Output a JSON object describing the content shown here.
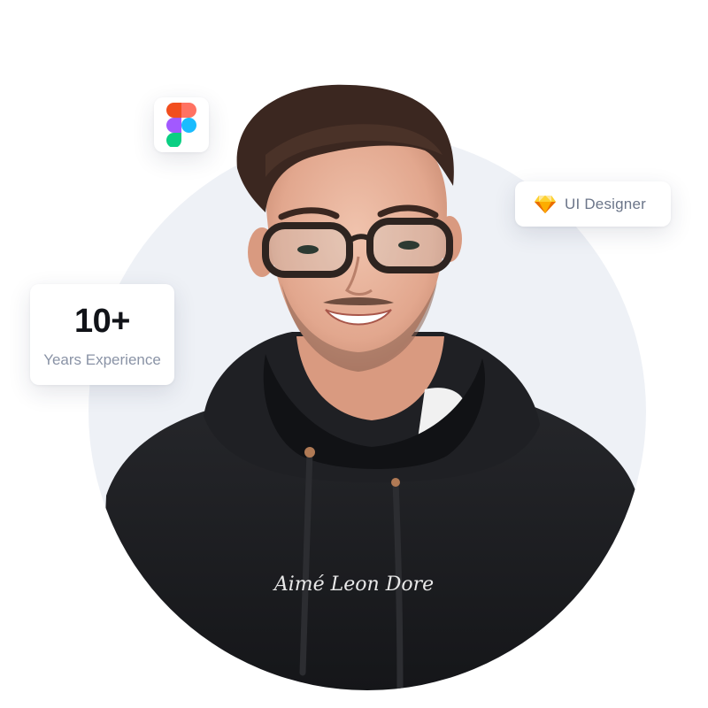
{
  "figma_badge": {
    "icon": "figma-logo-icon"
  },
  "role_badge": {
    "icon": "sketch-diamond-icon",
    "label": "UI Designer"
  },
  "experience_card": {
    "value": "10+",
    "label": "Years Experience"
  },
  "portrait": {
    "hoodie_brand_text": "Aimé Leon Dore"
  },
  "colors": {
    "backdrop": "#eef1f6",
    "hoodie": "#1b1c1f",
    "card": "#ffffff",
    "muted_text": "#8a93a6",
    "sketch_orange": "#f7b52c"
  }
}
